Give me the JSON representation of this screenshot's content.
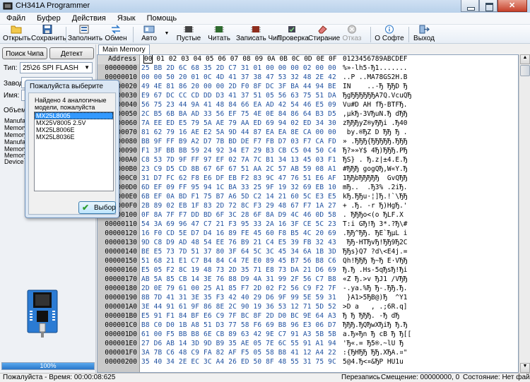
{
  "window": {
    "title": "CH341A Programmer"
  },
  "menu": [
    "Файл",
    "Буфер",
    "Действия",
    "Язык",
    "Помощь"
  ],
  "toolbar": {
    "open": "Открыть",
    "save": "Сохранить",
    "fill": "Заполнить",
    "swap": "Обмен",
    "auto": "Авто",
    "blank": "Пустые",
    "read": "Читать",
    "write": "Записать Чип",
    "verify": "Проверка",
    "erase": "Стирание",
    "cancel": "Отказ",
    "about": "О Софте",
    "exit": "Выход"
  },
  "left": {
    "search_chip": "Поиск Чипа",
    "detect": "Детект",
    "type_label": "Тип:",
    "type_value": "25\\26 SPI FLASH",
    "vendor_label": "Завод:",
    "name_label": "Имя:",
    "volume_label": "Объем",
    "info_labels": [
      "Manufac",
      "Memory",
      "Memory",
      "Manufac",
      "Memory",
      "Memory",
      "Device I"
    ],
    "progress_text": "100%",
    "progress_value": 100
  },
  "tab": {
    "label": "Main Memory"
  },
  "hex": {
    "address_header": "Address",
    "columns": [
      "00",
      "01",
      "02",
      "03",
      "04",
      "05",
      "06",
      "07",
      "08",
      "09",
      "0A",
      "0B",
      "0C",
      "0D",
      "0E",
      "0F"
    ],
    "ascii_header": "0123456789ABCDEF",
    "rows": [
      {
        "addr": "00000000",
        "hex": "25 BB 2D 6C 68 35 2D C7 31 01 00 00 00 02 00 00",
        "ascii": "%»-lh5-Ђ1......."
      },
      {
        "addr": "00000010",
        "hex": "00 00 50 20 01 0C 4D 41 37 38 47 53 32 48 2E 42",
        "ascii": "..P ..MA78GS2H.B"
      },
      {
        "addr": "00000020",
        "hex": "49 4E 81 86 20 00 00 2D F0 8F DC 3F BA 44 94 BE",
        "ascii": "IN    ..-Ђ ЂЂD Ђ"
      },
      {
        "addr": "00000030",
        "hex": "E9 67 DC CC CD DD D3 41 37 51 05 56 63 75 51 DA",
        "ascii": "ЂgЂЂЂЂЂЂA7Q.VcuQЂ"
      },
      {
        "addr": "00000040",
        "hex": "56 75 23 44 9A 41 48 84 66 EA AD 42 54 46 E5 09",
        "ascii": "Vu#D AH fЂ-BTFЂ."
      },
      {
        "addr": "00000050",
        "hex": "2C B5 6B BA AD 33 56 EF 75 4E 0E 84 86 64 B3 D5",
        "ascii": ",µkЂ-3VЂuN.Ђ dЂЂ"
      },
      {
        "addr": "00000060",
        "hex": "7A EE ED E5 79 5A AE 79 AA ED 69 94 02 ED 34 30",
        "ascii": "zЂЂЂyZ®yЂЂi .Ђ40"
      },
      {
        "addr": "00000070",
        "hex": "81 62 79 16 AE E2 5A 9D 44 87 EA EA 8E CA 00 00",
        "ascii": " by.®ЂZ D ЂЂ Ђ ."
      },
      {
        "addr": "00000080",
        "hex": "BB 9F FF B9 A2 D7 7B BD DE F7 FB D7 03 F7 CA FD",
        "ascii": "» .ЂЂЂ{ЂЂЂЂЂ.ЂЂЂ"
      },
      {
        "addr": "00000090",
        "hex": "F1 3F BB BB 59 24 92 34 E7 29 B3 CB C5 04 50 C4",
        "ascii": "Ђ?»»Y$ 4Ђ)ЂЂЂ.PЂ"
      },
      {
        "addr": "000000A0",
        "hex": "C8 53 7D 9F FF 97 EF 02 7A 7C B1 34 13 45 03 F1",
        "ascii": "ЂS} . Ђ.z|±4.E.Ђ"
      },
      {
        "addr": "000000B0",
        "hex": "23 C9 D5 CD 8B 67 6F 67 51 AA 2C 57 AB 59 08 A1",
        "ascii": "#ЂЂЂ gogQЂ,W«Y.Ђ"
      },
      {
        "addr": "000000C0",
        "hex": "31 D7 FC 62 F8 E6 DF EB F2 83 9C 47 76 51 E6 AF",
        "ascii": "1ЂЂbЂЂЂЂЂ  GvQЂЂ"
      },
      {
        "addr": "000000D0",
        "hex": "6D EF 09 FF 95 94 1C BA 33 25 9F 19 32 69 EB 10",
        "ascii": "mЂ..  .Ђ3% .2iЂ."
      },
      {
        "addr": "000000E0",
        "hex": "6B EF 0A BD F1 75 B7 A6 5D C2 14 21 60 5C E3 E5",
        "ascii": "kЂ.ЂЂu·¦]Ђ.!`\\ЂЂ"
      },
      {
        "addr": "000000F0",
        "hex": "2B 89 02 EB 1F 83 2D 72 8C F3 29 48 67 F7 1A 27",
        "ascii": "+ .Ђ. -r Ђ)HgЂ.'"
      },
      {
        "addr": "00000100",
        "hex": "0F 8A 7F F7 DD BD 6F 3C 28 6F 8A D9 4C 46 0D 58",
        "ascii": ". ЂЂЂo<(o ЂLF.X"
      },
      {
        "addr": "00000110",
        "hex": "54 3A 69 96 47 C7 21 F3 95 33 2A 16 3F CE 5C 23",
        "ascii": "T:i GЂ!Ђ 3*.?Ђ\\#"
      },
      {
        "addr": "00000120",
        "hex": "16 F0 CD 5E D7 D4 16 89 FE 45 60 F8 B5 4C 20 69",
        "ascii": ".ЂЂ^ЂЂ. ЂE`ЂµL i"
      },
      {
        "addr": "00000130",
        "hex": "9D C8 D9 AD 48 54 EE 76 B9 21 C4 E5 39 FB 32 43",
        "ascii": " ЂЂ-HTЂvЂ!ЂЂ9Ђ2C"
      },
      {
        "addr": "00000140",
        "hex": "BE E5 73 7D 51 37 80 3F 64 5C 3C 45 34 6A 1B 3D",
        "ascii": "ЂЂs}Q7 ?d\\<E4j.="
      },
      {
        "addr": "00000150",
        "hex": "51 68 21 E1 C7 B4 84 C4 7E E0 89 45 B7 56 B8 C6",
        "ascii": "Qh!ЂЂЂ Ђ~Ђ E·VЂЂ"
      },
      {
        "addr": "00000160",
        "hex": "E5 05 F2 8C 19 48 73 2D 35 71 E8 73 DA 21 D6 69",
        "ascii": "Ђ.Ђ .Hs-5qЂsЂ!Ђi"
      },
      {
        "addr": "00000170",
        "hex": "AB 5A 85 CB 14 3E 76 88 D9 4A 31 99 2F 56 C7 B8",
        "ascii": "«Z Ђ.>v ЂJ1 /VЂЂ"
      },
      {
        "addr": "00000180",
        "hex": "2D 0E 79 61 00 25 A1 85 F7 2D 02 F2 56 C9 F2 7F",
        "ascii": "-.ya.%Ђ Ђ-.ЂЂ.Ђ."
      },
      {
        "addr": "00000190",
        "hex": "8B 7D 41 31 3E 35 F3 42 40 29 D6 9F 99 5E 59 31",
        "ascii": " }A1>5ЂB@)Ђ  ^Y1"
      },
      {
        "addr": "000001A0",
        "hex": "3E 44 91 61 9F 86 8E 2C 90 19 36 53 12 71 5D 52",
        "ascii": ">D a   , .;6R.q]"
      },
      {
        "addr": "000001B0",
        "hex": "E5 91 F1 84 BF E6 C9 7F BC 8F 2D D0 BC 9E 64 A3",
        "ascii": "Ђ Ђ ЂЂЂ. -Ђ dЂ"
      },
      {
        "addr": "000001C0",
        "hex": "B8 C0 D0 1B A8 51 D3 77 58 F6 69 B8 96 E3 06 D7",
        "ascii": "ЂЂЂ.ЂQЂwXЂiЂ Ђ.Ђ"
      },
      {
        "addr": "000001D0",
        "hex": "61 00 F5 BB B8 6E CB 89 63 42 9E C7 91 A3 5B 5B",
        "ascii": "a.Ђ»Ђn Ђ cB Ђ Ђ[["
      },
      {
        "addr": "000001E0",
        "hex": "27 D6 AB 14 3D 9D B9 35 AE 05 7E 6C 55 91 A1 94",
        "ascii": "'Ђ«.= Ђ5®.~lU Ђ"
      },
      {
        "addr": "000001F0",
        "hex": "3A 7B C6 48 C9 FA 82 AF F5 05 58 B8 41 12 A4 22",
        "ascii": ":{ЂHЂЂ ЂЂ.XЂA.¤\""
      },
      {
        "addr": "00000200",
        "hex": "35 40 34 2E EC 3C A4 26 ED 50 8F 48 55 31 75 9C",
        "ascii": "5@4.Ђ<¤&ЂP HU1u"
      }
    ]
  },
  "dialog": {
    "title": "Пожалуйста выберите",
    "message": "Найдено 4 аналогичные модели, пожалуйста выберите",
    "items": [
      "MX25L8005",
      "MX25V8005 2.5V",
      "MX25L8006E",
      "MX25L8036E"
    ],
    "selected": "MX25L8005",
    "ok_label": "Выбор"
  },
  "status": {
    "time": "Пожалуйста - Время: 00:00:08:625",
    "mode": "Перезапись",
    "offset": "Смещение: 00000000, 0",
    "state": "Состояние: Нет файла"
  },
  "colors": {
    "hex_text": "#1e50a0",
    "selection": "#3399ff",
    "progress": "#2a77c9"
  }
}
